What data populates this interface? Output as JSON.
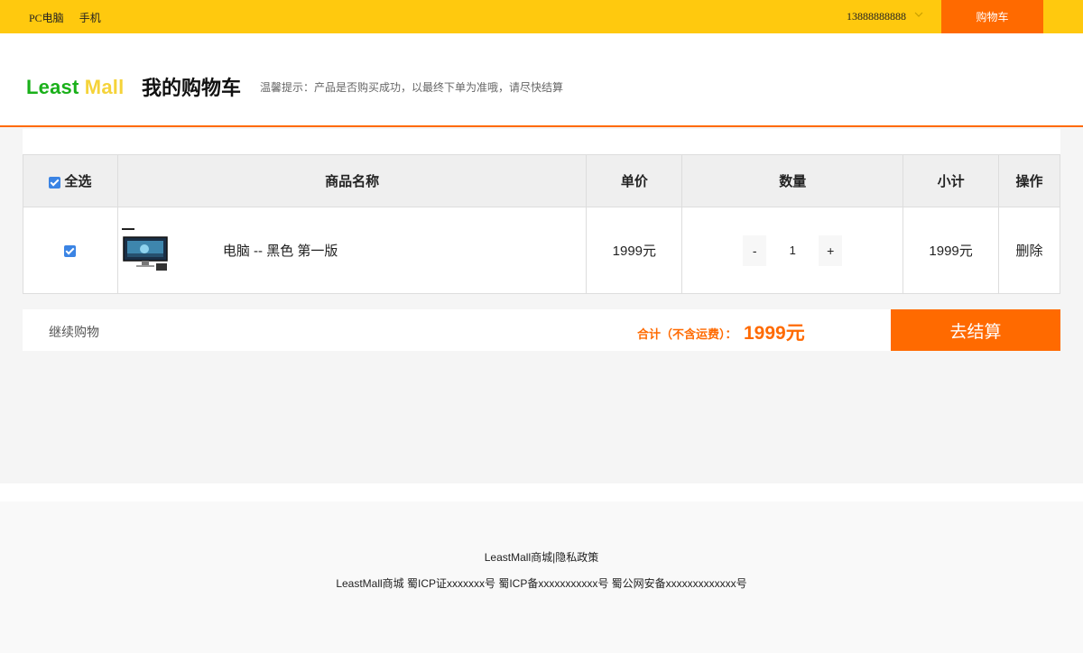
{
  "topbar": {
    "nav": [
      "PC电脑",
      "手机"
    ],
    "user": "13888888888",
    "cart_button": "购物车"
  },
  "header": {
    "logo_left": "Least",
    "logo_right": "Mall",
    "title": "我的购物车",
    "hint": "温馨提示：产品是否购买成功，以最终下单为准哦，请尽快结算"
  },
  "table": {
    "headers": {
      "select_all": "全选",
      "name": "商品名称",
      "price": "单价",
      "quantity": "数量",
      "subtotal": "小计",
      "action": "操作"
    },
    "rows": [
      {
        "name": "电脑 -- 黑色 第一版",
        "price": "1999元",
        "quantity": "1",
        "subtotal": "1999元",
        "delete": "删除",
        "minus": "-",
        "plus": "+"
      }
    ]
  },
  "summary": {
    "continue": "继续购物",
    "total_label": "合计（不含运费）：",
    "total_value": "1999元",
    "checkout": "去结算"
  },
  "footer": {
    "links": "LeastMall商城|隐私政策",
    "icp": "LeastMall商城 蜀ICP证xxxxxxx号 蜀ICP备xxxxxxxxxxx号 蜀公网安备xxxxxxxxxxxxx号"
  },
  "colors": {
    "topbar": "#ffc90e",
    "accent": "#ff6a00",
    "checkbox": "#3b84e4",
    "logo_green": "#1ab01a",
    "logo_yellow": "#f5d33a"
  }
}
